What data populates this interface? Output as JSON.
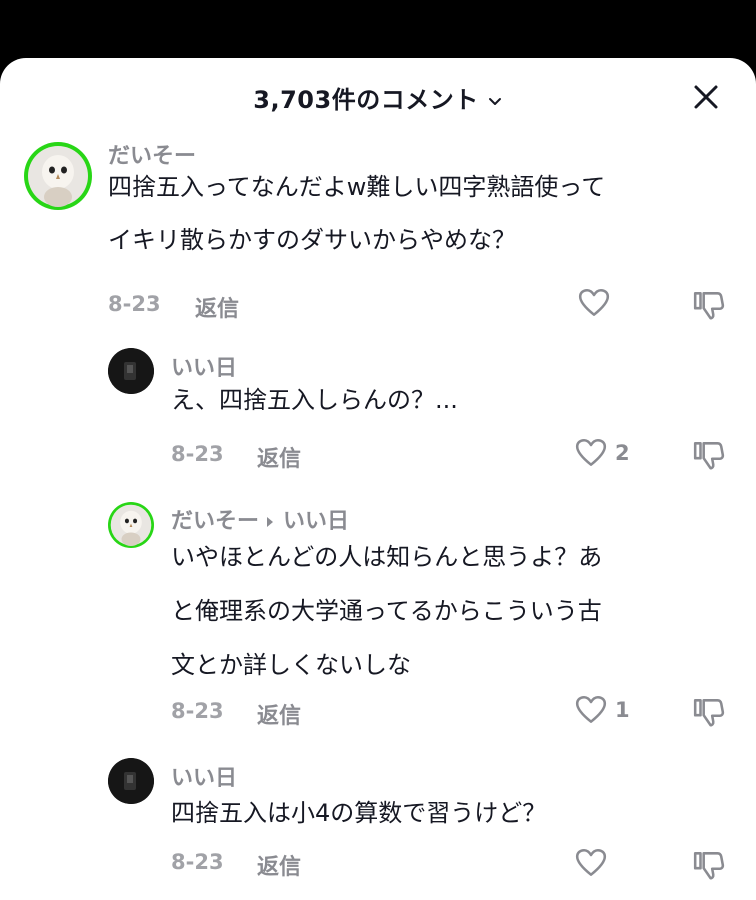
{
  "header": {
    "title": "3,703件のコメント",
    "icons": {
      "sort": "chevron-down-icon",
      "close": "close-icon"
    }
  },
  "comments": [
    {
      "username": "だいそー",
      "lines": [
        "四捨五入ってなんだよw難しい四字熟語使って",
        "イキリ散らかすのダサいからやめな？"
      ],
      "date": "8-23",
      "reply_label": "返信",
      "likes": "",
      "avatar": "owl-avatar"
    },
    {
      "username": "いい日",
      "lines": [
        "え、四捨五入しらんの？..."
      ],
      "date": "8-23",
      "reply_label": "返信",
      "likes": "2",
      "avatar": "dark-avatar"
    },
    {
      "username": "だいそー",
      "reply_to": "いい日",
      "lines": [
        "いやほとんどの人は知らんと思うよ？あ",
        "と俺理系の大学通ってるからこういう古",
        "文とか詳しくないしな"
      ],
      "date": "8-23",
      "reply_label": "返信",
      "likes": "1",
      "avatar": "owl-avatar"
    },
    {
      "username": "いい日",
      "lines": [
        "四捨五入は小4の算数で習うけど？"
      ],
      "date": "8-23",
      "reply_label": "返信",
      "likes": "",
      "avatar": "dark-avatar"
    }
  ],
  "colors": {
    "accent_avatar_bg": "#28d616",
    "username": "#8a8b91",
    "text": "#161823"
  }
}
